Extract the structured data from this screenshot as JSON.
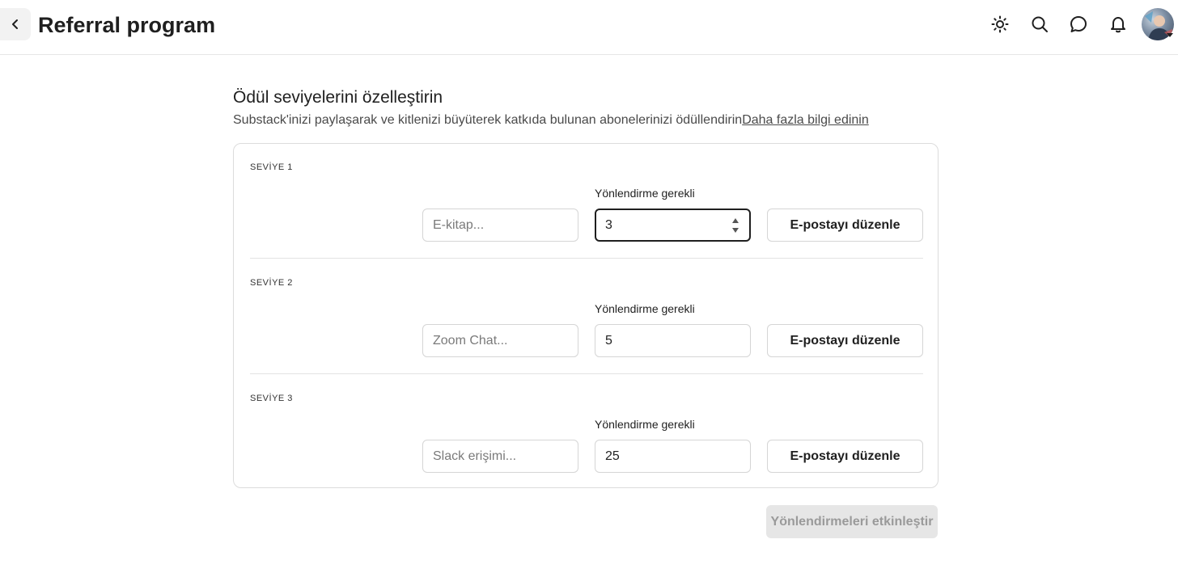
{
  "header": {
    "title": "Referral program",
    "icons": [
      "chevron-left-icon",
      "sun-icon",
      "search-icon",
      "chat-bubble-icon",
      "bell-icon"
    ]
  },
  "intro": {
    "title": "Ödül seviyelerini özelleştirin",
    "subtitle": "Substack'inizi paylaşarak ve kitlenizi büyüterek katkıda bulunan abonelerinizi ödüllendirin",
    "link": "Daha fazla bilgi edinin"
  },
  "tiers": [
    {
      "label": "SEVİYE 1",
      "required_label": "Yönlendirme gerekli",
      "reward_placeholder": "E-kitap...",
      "count": "3",
      "email_button": "E-postayı düzenle"
    },
    {
      "label": "SEVİYE 2",
      "required_label": "Yönlendirme gerekli",
      "reward_placeholder": "Zoom Chat...",
      "count": "5",
      "email_button": "E-postayı düzenle"
    },
    {
      "label": "SEVİYE 3",
      "required_label": "Yönlendirme gerekli",
      "reward_placeholder": "Slack erişimi...",
      "count": "25",
      "email_button": "E-postayı düzenle"
    }
  ],
  "footer": {
    "enable_button": "Yönlendirmeleri etkinleştir"
  },
  "colors": {
    "text": "#1f1f1f",
    "border": "#d5d5d5",
    "disabled_bg": "#e6e6e6",
    "disabled_text": "#9a9a9a"
  }
}
